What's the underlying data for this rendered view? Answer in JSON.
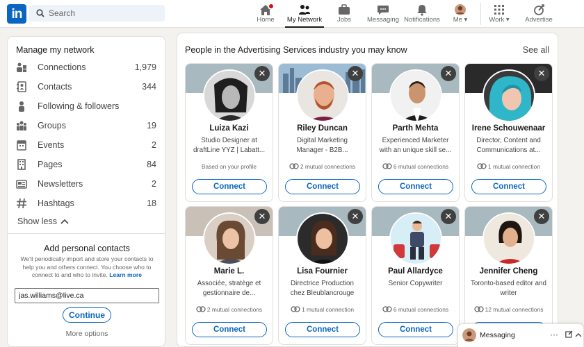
{
  "nav": {
    "search_placeholder": "Search",
    "items": [
      {
        "label": "Home"
      },
      {
        "label": "My Network"
      },
      {
        "label": "Jobs"
      },
      {
        "label": "Messaging"
      },
      {
        "label": "Notifications"
      },
      {
        "label": "Me"
      },
      {
        "label": "Work"
      },
      {
        "label": "Advertise"
      }
    ],
    "colors": {
      "brand": "#0a66c2",
      "notification": "#cc1016"
    }
  },
  "sidebar": {
    "title": "Manage my network",
    "items": [
      {
        "label": "Connections",
        "count": "1,979",
        "icon": "connections-icon"
      },
      {
        "label": "Contacts",
        "count": "344",
        "icon": "contacts-icon"
      },
      {
        "label": "Following & followers",
        "count": "",
        "icon": "person-icon"
      },
      {
        "label": "Groups",
        "count": "19",
        "icon": "groups-icon"
      },
      {
        "label": "Events",
        "count": "2",
        "icon": "calendar-icon"
      },
      {
        "label": "Pages",
        "count": "84",
        "icon": "building-icon"
      },
      {
        "label": "Newsletters",
        "count": "2",
        "icon": "newsletter-icon"
      },
      {
        "label": "Hashtags",
        "count": "18",
        "icon": "hashtag-icon"
      }
    ],
    "show_less": "Show less",
    "add_contacts": {
      "title": "Add personal contacts",
      "description": "We'll periodically import and store your contacts to help you and others connect. You choose who to connect to and who to invite.",
      "learn_more": "Learn more",
      "email_value": "jas.williams@live.ca",
      "continue_label": "Continue",
      "more_options": "More options"
    }
  },
  "suggestions": {
    "title": "People in the Advertising Services industry you may know",
    "see_all": "See all",
    "connect_label": "Connect",
    "people": [
      {
        "name": "Luiza Kazi",
        "title": "Studio Designer at draftLine YYZ | Labatt...",
        "meta": "Based on your profile",
        "mutual": false
      },
      {
        "name": "Riley Duncan",
        "title": "Digital Marketing Manager - B2B...",
        "meta": "2 mutual connections",
        "mutual": true
      },
      {
        "name": "Parth Mehta",
        "title": "Experienced Marketer with an unique skill se...",
        "meta": "6 mutual connections",
        "mutual": true
      },
      {
        "name": "Irene Schouwenaar",
        "title": "Director, Content and Communications at...",
        "meta": "1 mutual connection",
        "mutual": true
      },
      {
        "name": "Marie L.",
        "title": "Associée, stratège et gestionnaire de...",
        "meta": "2 mutual connections",
        "mutual": true
      },
      {
        "name": "Lisa Fournier",
        "title": "Directrice Production chez Bleublancrouge",
        "meta": "1 mutual connection",
        "mutual": true
      },
      {
        "name": "Paul Allardyce",
        "title": "Senior Copywriter",
        "meta": "6 mutual connections",
        "mutual": true
      },
      {
        "name": "Jennifer Cheng",
        "title": "Toronto-based editor and writer",
        "meta": "12 mutual connections",
        "mutual": true
      }
    ]
  },
  "messaging": {
    "label": "Messaging"
  }
}
